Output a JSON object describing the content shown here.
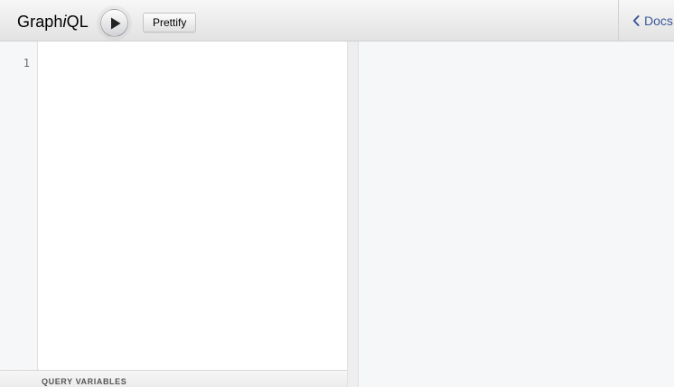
{
  "toolbar": {
    "title_prefix": "Graph",
    "title_italic": "i",
    "title_suffix": "QL",
    "execute_icon": "play-icon",
    "prettify_label": "Prettify"
  },
  "docs": {
    "icon": "chevron-left-icon",
    "label": "Docs",
    "color": "#3b5998"
  },
  "query_editor": {
    "line_numbers": [
      "1"
    ]
  },
  "variables": {
    "title": "QUERY VARIABLES"
  }
}
